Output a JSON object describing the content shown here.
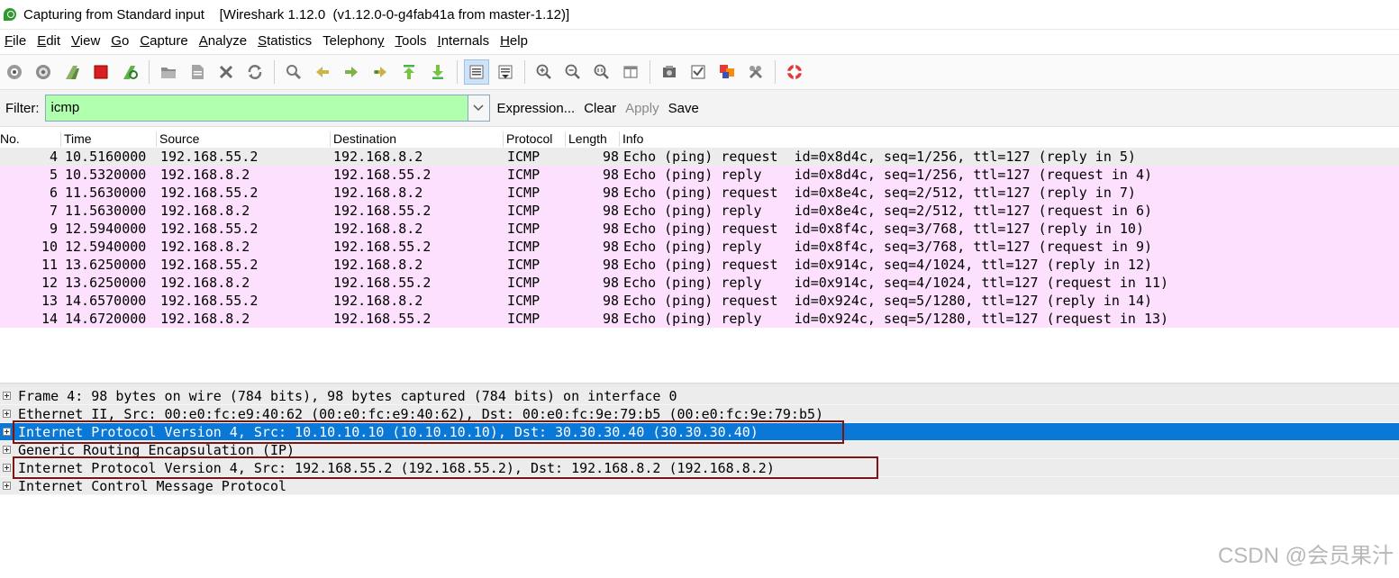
{
  "window": {
    "title": "Capturing from Standard input    [Wireshark 1.12.0  (v1.12.0-0-g4fab41a from master-1.12)]"
  },
  "menu": [
    {
      "u": "F",
      "rest": "ile"
    },
    {
      "u": "E",
      "rest": "dit"
    },
    {
      "u": "V",
      "rest": "iew"
    },
    {
      "u": "G",
      "rest": "o"
    },
    {
      "u": "C",
      "rest": "apture"
    },
    {
      "u": "A",
      "rest": "nalyze"
    },
    {
      "u": "S",
      "rest": "tatistics"
    },
    {
      "u": "",
      "rest": "Telephon",
      "u2": "y"
    },
    {
      "u": "T",
      "rest": "ools"
    },
    {
      "u": "I",
      "rest": "nternals"
    },
    {
      "u": "H",
      "rest": "elp"
    }
  ],
  "filter": {
    "label": "Filter:",
    "value": "icmp",
    "expression": "Expression...",
    "clear": "Clear",
    "apply": "Apply",
    "save": "Save"
  },
  "columns": {
    "no": "No.",
    "time": "Time",
    "source": "Source",
    "destination": "Destination",
    "protocol": "Protocol",
    "length": "Length",
    "info": "Info"
  },
  "packets": [
    {
      "no": "4",
      "time": "10.5160000",
      "src": "192.168.55.2",
      "dst": "192.168.8.2",
      "proto": "ICMP",
      "len": "98",
      "info": "Echo (ping) request  id=0x8d4c, seq=1/256, ttl=127 (reply in 5)"
    },
    {
      "no": "5",
      "time": "10.5320000",
      "src": "192.168.8.2",
      "dst": "192.168.55.2",
      "proto": "ICMP",
      "len": "98",
      "info": "Echo (ping) reply    id=0x8d4c, seq=1/256, ttl=127 (request in 4)"
    },
    {
      "no": "6",
      "time": "11.5630000",
      "src": "192.168.55.2",
      "dst": "192.168.8.2",
      "proto": "ICMP",
      "len": "98",
      "info": "Echo (ping) request  id=0x8e4c, seq=2/512, ttl=127 (reply in 7)"
    },
    {
      "no": "7",
      "time": "11.5630000",
      "src": "192.168.8.2",
      "dst": "192.168.55.2",
      "proto": "ICMP",
      "len": "98",
      "info": "Echo (ping) reply    id=0x8e4c, seq=2/512, ttl=127 (request in 6)"
    },
    {
      "no": "9",
      "time": "12.5940000",
      "src": "192.168.55.2",
      "dst": "192.168.8.2",
      "proto": "ICMP",
      "len": "98",
      "info": "Echo (ping) request  id=0x8f4c, seq=3/768, ttl=127 (reply in 10)"
    },
    {
      "no": "10",
      "time": "12.5940000",
      "src": "192.168.8.2",
      "dst": "192.168.55.2",
      "proto": "ICMP",
      "len": "98",
      "info": "Echo (ping) reply    id=0x8f4c, seq=3/768, ttl=127 (request in 9)"
    },
    {
      "no": "11",
      "time": "13.6250000",
      "src": "192.168.55.2",
      "dst": "192.168.8.2",
      "proto": "ICMP",
      "len": "98",
      "info": "Echo (ping) request  id=0x914c, seq=4/1024, ttl=127 (reply in 12)"
    },
    {
      "no": "12",
      "time": "13.6250000",
      "src": "192.168.8.2",
      "dst": "192.168.55.2",
      "proto": "ICMP",
      "len": "98",
      "info": "Echo (ping) reply    id=0x914c, seq=4/1024, ttl=127 (request in 11)"
    },
    {
      "no": "13",
      "time": "14.6570000",
      "src": "192.168.55.2",
      "dst": "192.168.8.2",
      "proto": "ICMP",
      "len": "98",
      "info": "Echo (ping) request  id=0x924c, seq=5/1280, ttl=127 (reply in 14)"
    },
    {
      "no": "14",
      "time": "14.6720000",
      "src": "192.168.8.2",
      "dst": "192.168.55.2",
      "proto": "ICMP",
      "len": "98",
      "info": "Echo (ping) reply    id=0x924c, seq=5/1280, ttl=127 (request in 13)"
    }
  ],
  "details": [
    {
      "text": "Frame 4: 98 bytes on wire (784 bits), 98 bytes captured (784 bits) on interface 0",
      "selected": false
    },
    {
      "text": "Ethernet II, Src: 00:e0:fc:e9:40:62 (00:e0:fc:e9:40:62), Dst: 00:e0:fc:9e:79:b5 (00:e0:fc:9e:79:b5)",
      "selected": false
    },
    {
      "text": "Internet Protocol Version 4, Src: 10.10.10.10 (10.10.10.10), Dst: 30.30.30.40 (30.30.30.40)",
      "selected": true
    },
    {
      "text": "Generic Routing Encapsulation (IP)",
      "selected": false
    },
    {
      "text": "Internet Protocol Version 4, Src: 192.168.55.2 (192.168.55.2), Dst: 192.168.8.2 (192.168.8.2)",
      "selected": false
    },
    {
      "text": "Internet Control Message Protocol",
      "selected": false
    }
  ],
  "watermark": "CSDN @会员果汁",
  "colors": {
    "filter_bg": "#afffaf",
    "row_selected": "#ececec",
    "row_icmp": "#fde0fd",
    "detail_selected": "#0a78d7",
    "highlight_box": "#7d1515"
  }
}
